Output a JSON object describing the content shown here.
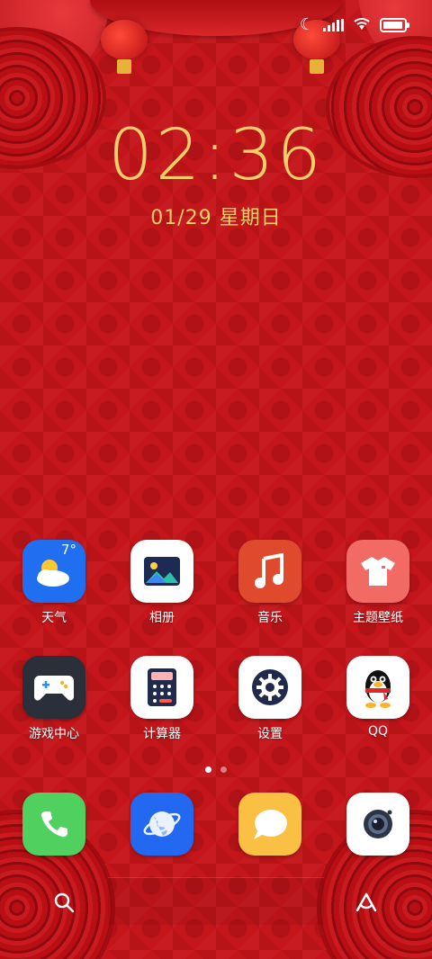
{
  "status_bar": {
    "icons": [
      "moon-icon",
      "signal-icon",
      "wifi-icon",
      "battery-icon"
    ]
  },
  "lock": {
    "time": "02:36",
    "date": "01/29 星期日"
  },
  "apps_row1": [
    {
      "label": "天气",
      "icon": "weather-icon",
      "badge": "7°",
      "bg": "#1f6ff0"
    },
    {
      "label": "相册",
      "icon": "gallery-icon",
      "bg": "#ffffff"
    },
    {
      "label": "音乐",
      "icon": "music-icon",
      "bg": "#e04a2c"
    },
    {
      "label": "主题壁纸",
      "icon": "theme-shirt-icon",
      "bg": "#f26a64"
    }
  ],
  "apps_row2": [
    {
      "label": "游戏中心",
      "icon": "gamepad-icon",
      "bg": "#2b2f3a"
    },
    {
      "label": "计算器",
      "icon": "calculator-icon",
      "bg": "#ffffff"
    },
    {
      "label": "设置",
      "icon": "gear-icon",
      "bg": "#ffffff"
    },
    {
      "label": "QQ",
      "icon": "qq-penguin-icon",
      "bg": "#ffffff"
    }
  ],
  "dock": [
    {
      "icon": "phone-icon",
      "bg": "#4fd05f"
    },
    {
      "icon": "browser-planet-icon",
      "bg": "#2268f0"
    },
    {
      "icon": "messages-icon",
      "bg": "#f9c043"
    },
    {
      "icon": "camera-icon",
      "bg": "#ffffff"
    }
  ],
  "page_indicator": {
    "pages": 2,
    "current": 1
  },
  "bottom": {
    "left_icon": "search-icon",
    "right_icon": "assistant-a-icon"
  }
}
